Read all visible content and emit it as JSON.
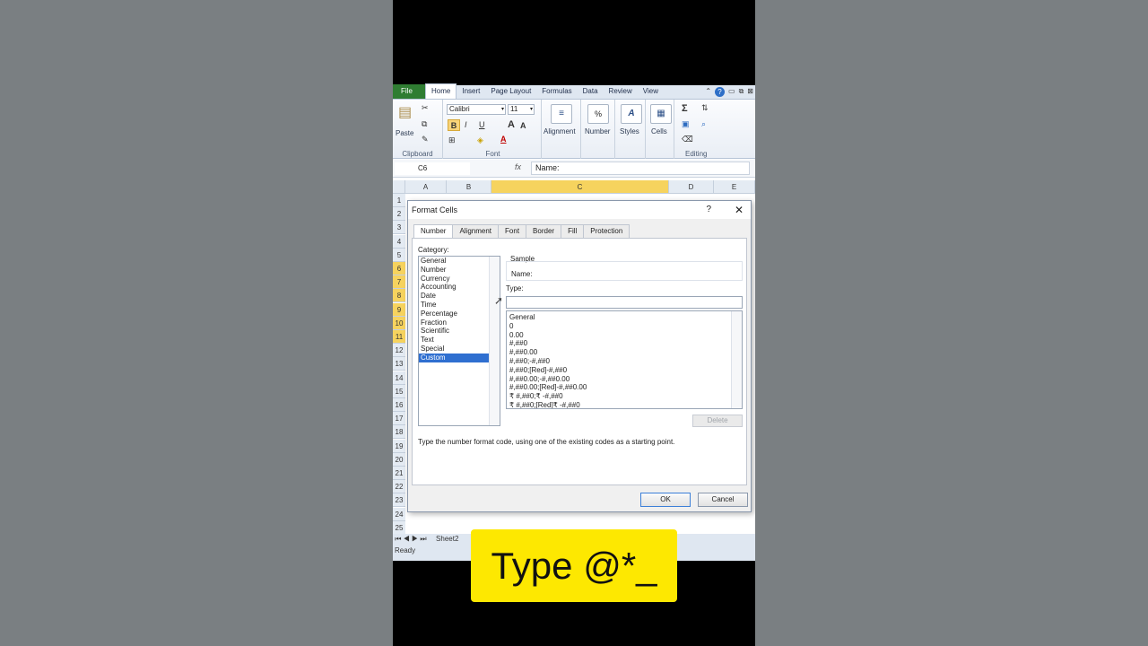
{
  "ribbon_tabs": [
    "File",
    "Home",
    "Insert",
    "Page Layout",
    "Formulas",
    "Data",
    "Review",
    "View"
  ],
  "ribbon": {
    "clipboard": {
      "paste": "Paste",
      "label": "Clipboard"
    },
    "font": {
      "name": "Calibri",
      "size": "11",
      "label": "Font",
      "bold": "B",
      "italic": "I",
      "underline": "U",
      "grow": "A",
      "shrink": "A"
    },
    "alignment": {
      "label": "Alignment"
    },
    "number": {
      "label": "Number",
      "symbol": "%"
    },
    "styles": {
      "label": "Styles"
    },
    "cells": {
      "label": "Cells"
    },
    "editing": {
      "label": "Editing",
      "sum": "Σ"
    }
  },
  "formula_bar": {
    "name_box": "C6",
    "fx": "fx",
    "value": "Name:"
  },
  "columns": [
    "A",
    "B",
    "C",
    "D",
    "E"
  ],
  "rows": [
    "1",
    "2",
    "3",
    "4",
    "5",
    "6",
    "7",
    "8",
    "9",
    "10",
    "11",
    "12",
    "13",
    "14",
    "15",
    "16",
    "17",
    "18",
    "19",
    "20",
    "21",
    "22",
    "23",
    "24",
    "25"
  ],
  "selected_rows": [
    "6",
    "7",
    "8",
    "9",
    "10",
    "11"
  ],
  "status": {
    "ready": "Ready",
    "sheet_tab": "Sheet2"
  },
  "dialog": {
    "title": "Format Cells",
    "help": "?",
    "close": "✕",
    "tabs": [
      "Number",
      "Alignment",
      "Font",
      "Border",
      "Fill",
      "Protection"
    ],
    "category_label": "Category:",
    "categories": [
      "General",
      "Number",
      "Currency",
      "Accounting",
      "Date",
      "Time",
      "Percentage",
      "Fraction",
      "Scientific",
      "Text",
      "Special",
      "Custom"
    ],
    "selected_category": "Custom",
    "sample_label": "Sample",
    "sample_value": "Name:",
    "type_label": "Type:",
    "type_value": "",
    "types": [
      "General",
      "0",
      "0.00",
      "#,##0",
      "#,##0.00",
      "#,##0;-#,##0",
      "#,##0;[Red]-#,##0",
      "#,##0.00;-#,##0.00",
      "#,##0.00;[Red]-#,##0.00",
      "₹ #,##0;₹ -#,##0",
      "₹ #,##0;[Red]₹ -#,##0"
    ],
    "delete_label": "Delete",
    "hint": "Type the number format code, using one of the existing codes as a starting point.",
    "ok_label": "OK",
    "cancel_label": "Cancel"
  },
  "caption": "Type @*_"
}
